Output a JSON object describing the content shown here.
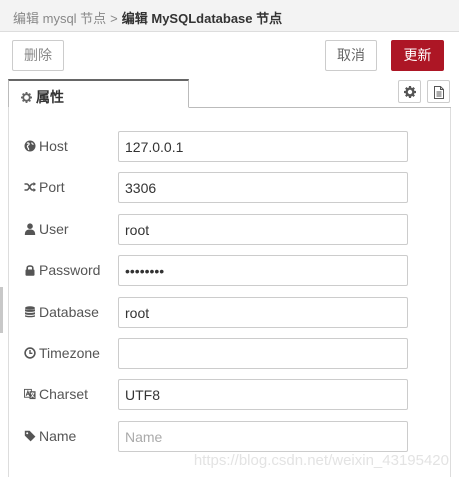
{
  "breadcrumb": {
    "parent": "编辑 mysql 节点",
    "separator": ">",
    "current": "编辑 MySQLdatabase 节点"
  },
  "toolbar": {
    "delete_label": "删除",
    "cancel_label": "取消",
    "update_label": "更新",
    "update_color": "#ad1625"
  },
  "tabs": [
    {
      "label": "属性",
      "icon": "gear-icon",
      "active": true
    }
  ],
  "tab_icons": [
    "gear-icon",
    "description-icon"
  ],
  "form": {
    "host": {
      "label": "Host",
      "icon": "globe-icon",
      "value": "127.0.0.1"
    },
    "port": {
      "label": "Port",
      "icon": "shuffle-icon",
      "value": "3306"
    },
    "user": {
      "label": "User",
      "icon": "user-icon",
      "value": "root"
    },
    "password": {
      "label": "Password",
      "icon": "lock-icon",
      "value": "••••••••"
    },
    "database": {
      "label": "Database",
      "icon": "database-icon",
      "value": "root"
    },
    "timezone": {
      "label": "Timezone",
      "icon": "clock-icon",
      "value": ""
    },
    "charset": {
      "label": "Charset",
      "icon": "language-icon",
      "value": "UTF8"
    },
    "name": {
      "label": "Name",
      "icon": "tag-icon",
      "value": "",
      "placeholder": "Name"
    }
  },
  "watermark": "https://blog.csdn.net/weixin_43195420"
}
